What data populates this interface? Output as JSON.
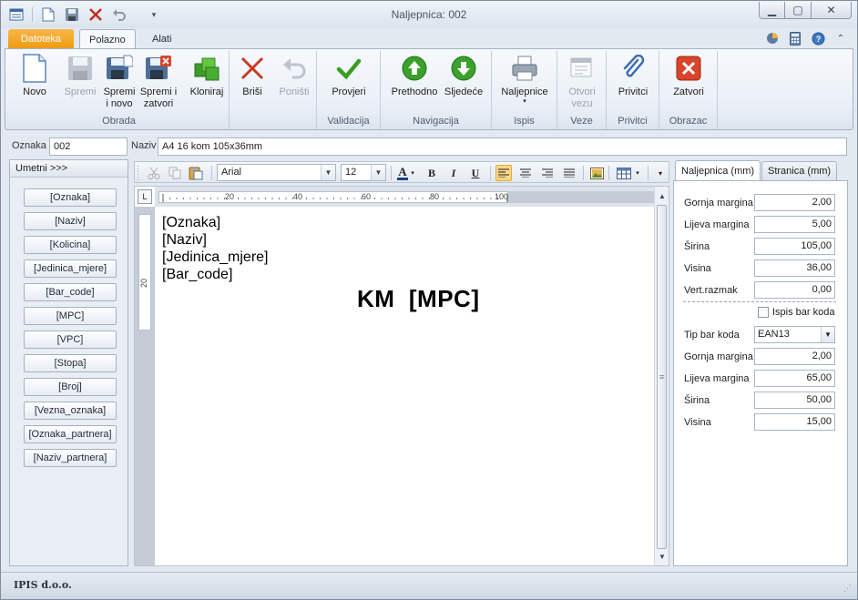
{
  "window": {
    "title": "Naljepnica: 002"
  },
  "quick_access": {
    "icons": [
      "grid-icon",
      "new-icon",
      "save-icon",
      "close-x-icon",
      "undo-icon",
      "dropdown-icon"
    ]
  },
  "tabs": [
    {
      "label": "Datoteka"
    },
    {
      "label": "Polazno"
    },
    {
      "label": "Alati"
    }
  ],
  "ribbon": {
    "groups": {
      "obrada": "Obrada",
      "validacija": "Validacija",
      "navigacija": "Navigacija",
      "ispis": "Ispis",
      "veze": "Veze",
      "privitci": "Privitci",
      "obrazac": "Obrazac"
    },
    "buttons": {
      "novo": "Novo",
      "spremi": "Spremi",
      "spremi_novo": "Spremi\ni novo",
      "spremi_zatvori": "Spremi i\nzatvori",
      "kloniraj": "Kloniraj",
      "brisi": "Briši",
      "ponisti": "Poništi",
      "provjeri": "Provjeri",
      "prethodno": "Prethodno",
      "sljedece": "Sljedeće",
      "naljepnice": "Naljepnice",
      "otvori_vezu": "Otvori\nvezu",
      "privitci": "Privitci",
      "zatvori": "Zatvori"
    }
  },
  "fields": {
    "oznaka_label": "Oznaka",
    "oznaka_value": "002",
    "naziv_label": "Naziv",
    "naziv_value": "A4 16 kom 105x36mm"
  },
  "insert_panel": {
    "header": "Umetni >>>",
    "items": [
      "[Oznaka]",
      "[Naziv]",
      "[Kolicina]",
      "[Jedinica_mjere]",
      "[Bar_code]",
      "[MPC]",
      "[VPC]",
      "[Stopa]",
      "[Broj]",
      "[Vezna_oznaka]",
      "[Oznaka_partnera]",
      "[Naziv_partnera]"
    ]
  },
  "editor": {
    "font": "Arial",
    "size": "12",
    "ruler_top": [
      "20",
      "40",
      "60",
      "80",
      "100"
    ],
    "ruler_left": "20",
    "lines": [
      "[Oznaka]",
      "[Naziv]",
      "[Jedinica_mjere]",
      "[Bar_code]"
    ],
    "title_line": "KM  [MPC]"
  },
  "right_panel": {
    "tabs": [
      "Naljepnica (mm)",
      "Stranica (mm)"
    ],
    "label_rows": [
      {
        "label": "Gornja margina",
        "value": "2,00"
      },
      {
        "label": "Lijeva margina",
        "value": "5,00"
      },
      {
        "label": "Širina",
        "value": "105,00"
      },
      {
        "label": "Visina",
        "value": "36,00"
      },
      {
        "label": "Vert.razmak",
        "value": "0,00"
      }
    ],
    "checkbox_label": "Ispis bar koda",
    "tip_label": "Tip bar koda",
    "tip_value": "EAN13",
    "barcode_rows": [
      {
        "label": "Gornja margina",
        "value": "2,00"
      },
      {
        "label": "Lijeva margina",
        "value": "65,00"
      },
      {
        "label": "Širina",
        "value": "50,00"
      },
      {
        "label": "Visina",
        "value": "15,00"
      }
    ]
  },
  "status": {
    "company": "IPIS d.o.o."
  },
  "colors": {
    "accent_orange": "#f09a12",
    "ribbon_bg": "#eaf0f7",
    "window_bg": "#e3e9f1"
  }
}
